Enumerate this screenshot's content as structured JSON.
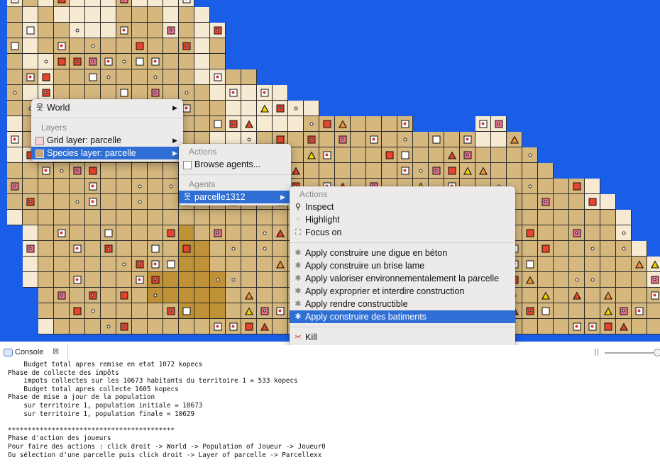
{
  "colors": {
    "water": "#1a5ee8",
    "sand_light": "#f6ead3",
    "sand_mid": "#d6b87f",
    "sand_dark": "#bf9238",
    "menu_bg": "#ecebea",
    "menu_highlight": "#2f6fd5",
    "red_marker": "#e8432c",
    "yellow_marker": "#f0d000"
  },
  "map": {
    "legend": {
      "w": "water",
      "l": "sand_light",
      "m": "sand_mid",
      "d": "sand_dark"
    },
    "rows": [
      "lmlmlllmllllwwwwwwwwwwwwwwwwwwwwwwwwwwwwwwwwwwww",
      "mlmllllmmmlmlwwwwwwwwwwwwwwwwwwwwwwwwwwwwwwwwwww",
      "mlmmlllmmmlmllwwwwwwwwwwwwwwwwwwwwwwwwwwwwwwwwww",
      "mlmmmmmmmmmmlmwwwwwwwwwwwwwwwwwwwwwwwwwwwwwwwwww",
      "mllmmmmmmmmmlmwwwwwwwwwwwwwwwwwwwwwwwwwwwwwwwwww",
      "mmlmmmmmmmmmllmmwwwwwwwwwwwwwwwwwwwwwwwwwwwwwwww",
      "mllmmmmmmmmmmlllllwwwwwwwwwwwwwwwwwwwwwwwwwwwwww",
      "mmlmmmmmmmmmmmllllllwwwwwwwwwwwwwwwwwwwwwwwwwwww",
      "lmmmmmmmmmmmmmlllllmmmmmmmwwwwllwwwwwwwwwwwwwwww",
      "lmlmmmmmmmmmmlllmmmmmmmmmmmmmmllmwwwwwwwwwwwwwww",
      "lllmmmmmmmmmmmmmmmmmmmmmmmmmmmmmmmwwwwwwwwwwwwww",
      "mmmmmmmmmmmmmmmmmmmmmmmmmmmmmmmmmmmwwwwwwwwwwwww",
      "mmmmmmmmmmmmmmmmmmmmmmmmmmmmmmmmmmmmmlwwwwwwwwww",
      "mmmmmmmmmmmmmmmmmmmmmmmmmmmmmmmmmmmmmllwwwwwwwww",
      "lmmmmmmmmmmmmmmmmmmmmmmmmmmmmmmmmmmmmmmlwwwwwwww",
      "wlmmmmmmmmmdmmmmmmmmmmmmmmmmmmmmmmmmmmmlwwwwwwww",
      "wlmmmmmmmmmddmmmmmmmmmmmmmmmmmmmmmmmmmmmlwwwwwww",
      "wlmmmmmmmmmddmmmmmmmmmmmmmmmmmmmmmmmmmmmmlwwwwww",
      "wlmmmmmmmdddddmmmmmmmmmmmmmmmmmmmmmmmmmmmlwwwwww",
      "wwmmmmmmmdddddmmmmmmmmmmmmmmmmmmmmmmmmmmmmlwwwww",
      "wwmmmmmmmmmdddmmmmmmmmmmmmmmmmmmmmmmmmmmmmmwwwww",
      "wwlmmmmmmmmmmmmmmmmmmmmmmmmmmmmmmmmmmmmmmmmmwwww"
    ]
  },
  "context_menu": {
    "world": "World",
    "layers_header": "Layers",
    "grid_layer": "Grid layer: parcelle",
    "species_layer": "Species layer: parcelle"
  },
  "sub_menu": {
    "actions_header": "Actions",
    "browse_agents": "Browse agents...",
    "agents_header": "Agents",
    "agent_name": "parcelle1312"
  },
  "agent_menu": {
    "actions_header": "Actions",
    "inspect": "Inspect",
    "highlight": "Highlight",
    "focus_on": "Focus on",
    "apply_actions": [
      "Apply construire une digue en béton",
      "Apply construire un brise lame",
      "Apply valoriser environnementalement la parcelle",
      "Apply exproprier et interdire construction",
      "Apply rendre constructible",
      "Apply construire des batiments"
    ],
    "selected_index": 5,
    "kill": "Kill"
  },
  "console": {
    "tab_label": "Console",
    "lines": [
      "    Budget total apres remise en etat 1072 kopecs",
      "Phase de collecte des impôts",
      "    impots collectes sur les 10673 habitants du territoire 1 = 533 kopecs",
      "    Budget total apres collecte 1605 kopecs",
      "Phase de mise a jour de la population",
      "    sur territoire 1, population initiale = 10673",
      "    sur territoire 1, population finale = 10629",
      "",
      "******************************************",
      "Phase d'action des joueurs",
      "Pour faire des actions : click droit -> World -> Population of Joueur -> Joueur0",
      "Ou sélection d'une parcelle puis click droit -> Layer of parcelle -> Parcellexx"
    ]
  }
}
